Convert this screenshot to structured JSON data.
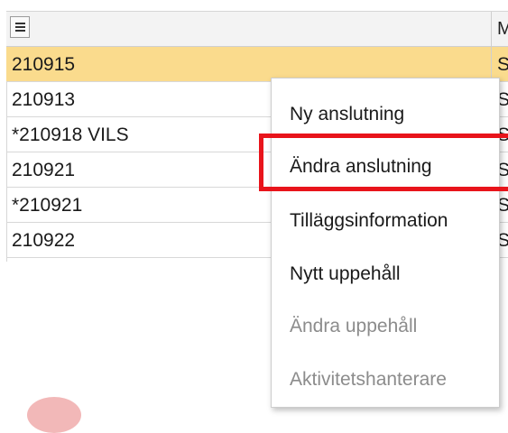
{
  "grid": {
    "header": {
      "col2": "M"
    },
    "rows": [
      {
        "c1": "210915",
        "c2": "S",
        "selected": true
      },
      {
        "c1": "210913",
        "c2": "S"
      },
      {
        "c1": "*210918 VILS",
        "c2": "S"
      },
      {
        "c1": "210921",
        "c2": "S"
      },
      {
        "c1": "*210921",
        "c2": "S"
      },
      {
        "c1": "210922",
        "c2": "S"
      }
    ]
  },
  "context_menu": {
    "items": [
      {
        "label": "Ny anslutning",
        "enabled": true
      },
      {
        "label": "Ändra anslutning",
        "enabled": true
      },
      {
        "label": "Tilläggsinformation",
        "enabled": true
      },
      {
        "label": "Nytt uppehåll",
        "enabled": true
      },
      {
        "label": "Ändra uppehåll",
        "enabled": false
      },
      {
        "label": "Aktivitetshanterare",
        "enabled": false
      }
    ]
  },
  "colors": {
    "selected_row": "#fadb8d",
    "highlight_border": "#e8141b",
    "disabled_text": "#8c8c8c"
  }
}
